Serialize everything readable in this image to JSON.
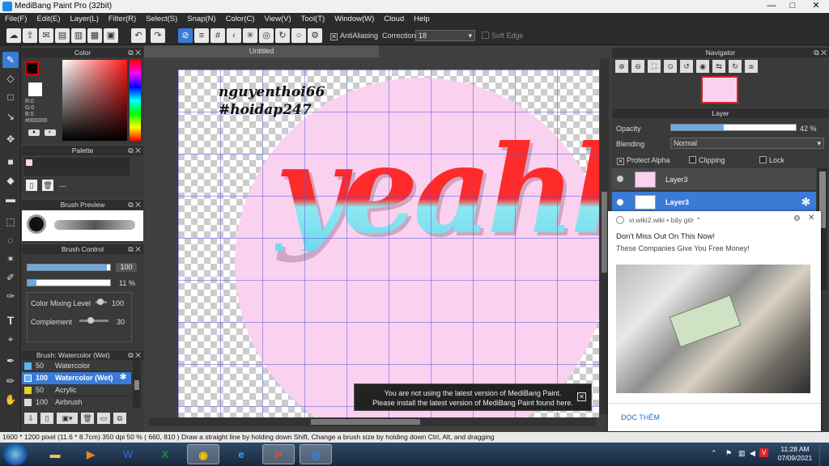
{
  "window": {
    "title": "MediBang Paint Pro (32bit)",
    "minimize": "—",
    "maximize": "□",
    "close": "✕"
  },
  "menu": [
    "File(F)",
    "Edit(E)",
    "Layer(L)",
    "Filter(R)",
    "Select(S)",
    "Snap(N)",
    "Color(C)",
    "View(V)",
    "Tool(T)",
    "Window(W)",
    "Cloud",
    "Help"
  ],
  "toolbar": {
    "antialiasing": "AntiAliasing",
    "correction_label": "Correction",
    "correction_value": "18",
    "soft_edge": "Soft Edge"
  },
  "panels": {
    "color": {
      "title": "Color",
      "r": "R:0",
      "g": "G:0",
      "b": "B:0",
      "hex": "#000000"
    },
    "palette": {
      "title": "Palette",
      "more": "---"
    },
    "brush_preview": {
      "title": "Brush Preview"
    },
    "brush_control": {
      "title": "Brush Control",
      "size": "100",
      "opacity": "11 %",
      "mixing_label": "Color Mixing Level",
      "mixing_value": "100",
      "complement_label": "Complement",
      "complement_value": "30"
    },
    "brush_list": {
      "title": "Brush: Watercolor (Wet)",
      "items": [
        {
          "size": "50",
          "name": "Watercolor",
          "color": "#5ab4f0"
        },
        {
          "size": "100",
          "name": "Watercolor (Wet)",
          "color": "#5ab4f0"
        },
        {
          "size": "50",
          "name": "Acrylic",
          "color": "#e6d21e"
        },
        {
          "size": "100",
          "name": "Airbrush",
          "color": "#dddddd"
        }
      ]
    }
  },
  "canvas": {
    "tab": "Untitled",
    "handle1": "nguyenthoi66",
    "handle2": "#hoidap247",
    "art_text": "yeahh"
  },
  "navigator": {
    "title": "Navigator"
  },
  "layer": {
    "title": "Layer",
    "opacity_label": "Opacity",
    "opacity_value": "42 %",
    "opacity_fraction": 0.42,
    "blending_label": "Blending",
    "blending_value": "Normal",
    "protect_alpha": "Protect Alpha",
    "clipping": "Clipping",
    "lock": "Lock",
    "layers": [
      "Layer3",
      "Layer3"
    ]
  },
  "notice": {
    "line1": "You are not using the latest version of MediBang Paint.",
    "line2": "Please install the latest version of MediBang Paint found here."
  },
  "ad": {
    "source": "vi.wiki2.wiki",
    "time": "bây giờ",
    "headline": "Don't Miss Out On This Now!",
    "subline": "These Companies Give You Free Money!",
    "cta": "ĐỌC THÊM"
  },
  "statusbar": {
    "text": "1600 * 1200 pixel   (11.6 * 8.7cm)   350 dpi   50 %   ( 660, 810 )   Draw a straight line by holding down Shift, Change a brush size by holding down Ctrl, Alt, and dragging"
  },
  "taskbar": {
    "time": "11:28 AM",
    "date": "07/09/2021"
  }
}
